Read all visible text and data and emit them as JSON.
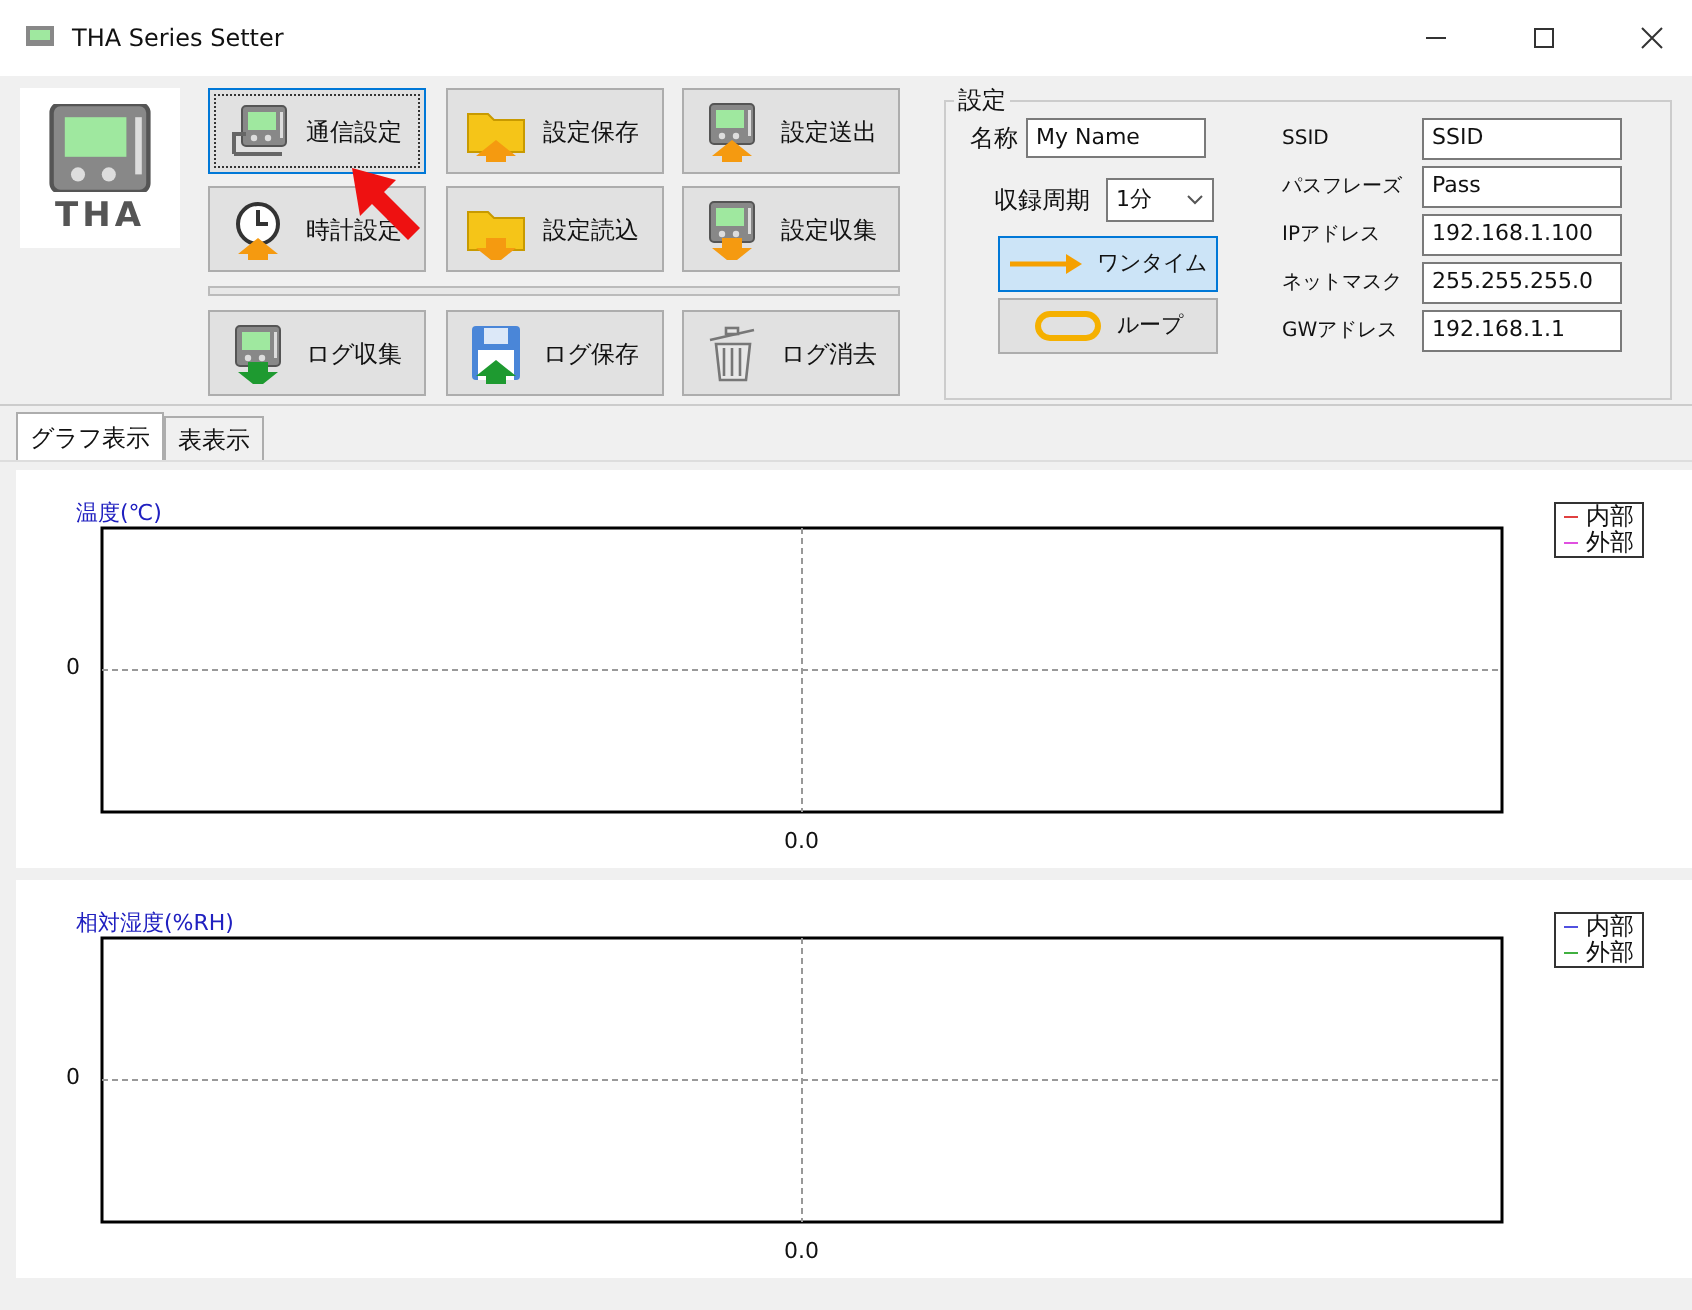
{
  "window": {
    "title": "THA Series Setter"
  },
  "logo": {
    "text": "THA"
  },
  "buttons": [
    {
      "label": "通信設定",
      "kind": "connect",
      "focused": true
    },
    {
      "label": "設定保存",
      "kind": "folder-up",
      "focused": false
    },
    {
      "label": "設定送出",
      "kind": "device-up",
      "focused": false
    },
    {
      "label": "時計設定",
      "kind": "clock-up",
      "focused": false
    },
    {
      "label": "設定読込",
      "kind": "folder-down",
      "focused": false
    },
    {
      "label": "設定収集",
      "kind": "device-down",
      "focused": false
    },
    {
      "label": "ログ収集",
      "kind": "device-green-down",
      "focused": false
    },
    {
      "label": "ログ保存",
      "kind": "floppy",
      "focused": false
    },
    {
      "label": "ログ消去",
      "kind": "trash",
      "focused": false
    }
  ],
  "settings": {
    "title": "設定",
    "name_label": "名称",
    "name_value": "My Name",
    "period_label": "収録周期",
    "period_value": "1分",
    "modes": [
      {
        "label": "ワンタイム",
        "kind": "arrow",
        "selected": true
      },
      {
        "label": "ループ",
        "kind": "loop",
        "selected": false
      }
    ],
    "network": [
      {
        "label": "SSID",
        "value": "SSID"
      },
      {
        "label": "パスフレーズ",
        "value": "Pass"
      },
      {
        "label": "IPアドレス",
        "value": "192.168.1.100"
      },
      {
        "label": "ネットマスク",
        "value": "255.255.255.0"
      },
      {
        "label": "GWアドレス",
        "value": "192.168.1.1"
      }
    ]
  },
  "tabs": [
    {
      "label": "グラフ表示",
      "selected": true
    },
    {
      "label": "表表示",
      "selected": false
    }
  ],
  "charts": [
    {
      "title": "温度(℃)",
      "x_label": "0.0",
      "y_label": "0",
      "legend": [
        {
          "name": "内部",
          "color": "#e04040"
        },
        {
          "name": "外部",
          "color": "#e050e0"
        }
      ]
    },
    {
      "title": "相対湿度(%RH)",
      "x_label": "0.0",
      "y_label": "0",
      "legend": [
        {
          "name": "内部",
          "color": "#5050e0"
        },
        {
          "name": "外部",
          "color": "#40b040"
        }
      ]
    }
  ]
}
